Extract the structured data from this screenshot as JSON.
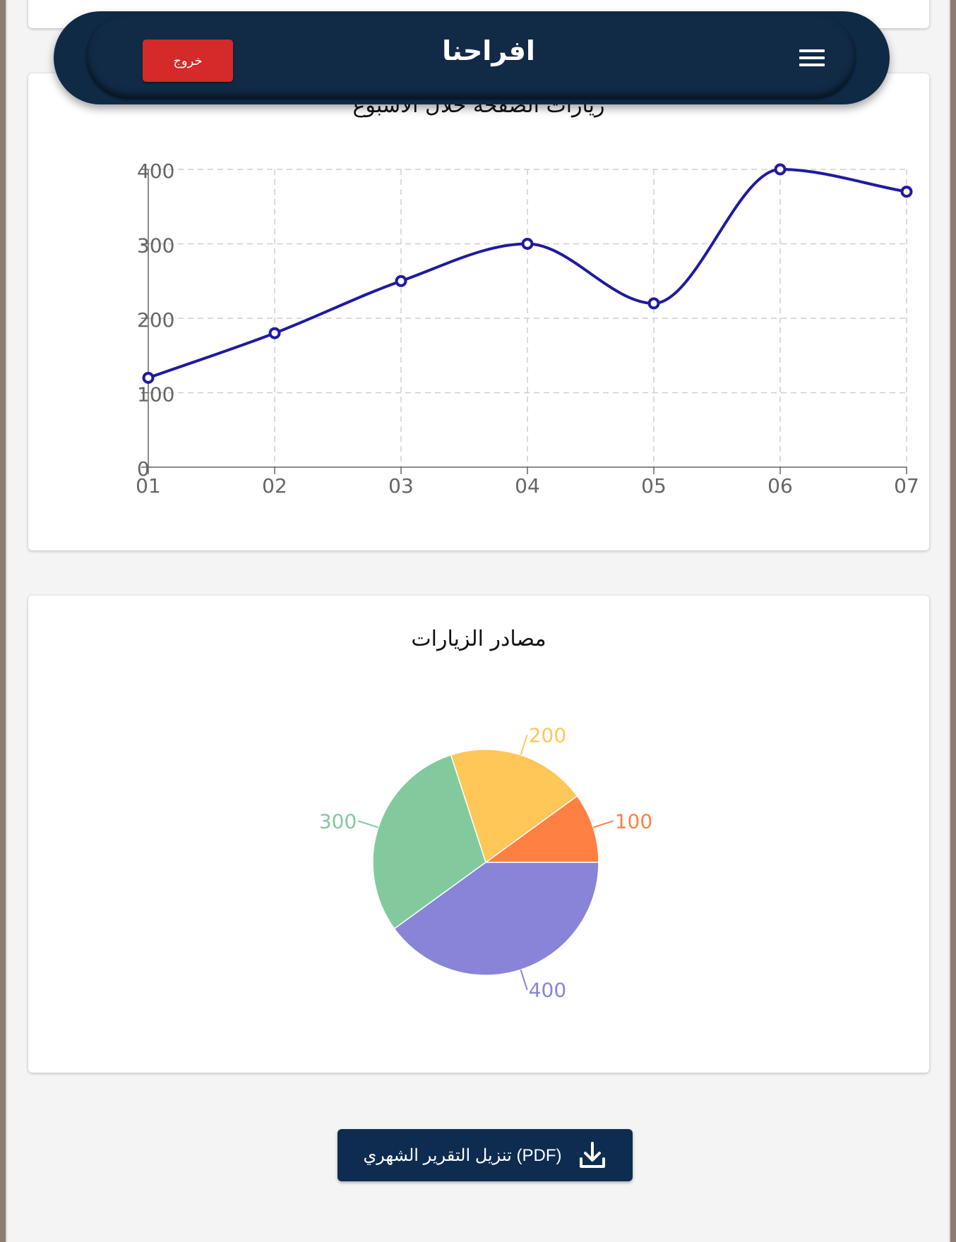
{
  "header": {
    "brand": "افراحنا",
    "logout_label": "خروج",
    "menu_icon": "hamburger-menu-icon"
  },
  "line_chart": {
    "title": "زيارات الصفحة خلال الأسبوع"
  },
  "pie_chart": {
    "title": "مصادر الزيارات"
  },
  "download": {
    "label": "تنزيل التقرير الشهري (PDF)",
    "icon": "download-icon"
  },
  "chart_data": [
    {
      "type": "line",
      "title": "زيارات الصفحة خلال الأسبوع",
      "categories": [
        "01",
        "02",
        "03",
        "04",
        "05",
        "06",
        "07"
      ],
      "series": [
        {
          "values": [
            120,
            180,
            250,
            300,
            220,
            400,
            370
          ],
          "color": "#1f1aa0"
        }
      ],
      "ylim": [
        0,
        400
      ],
      "yticks": [
        0,
        100,
        200,
        300,
        400
      ],
      "grid": true,
      "curve": "smooth"
    },
    {
      "type": "pie",
      "title": "مصادر الزيارات",
      "slices": [
        {
          "value": 100,
          "label": "100",
          "color": "#ff8042"
        },
        {
          "value": 200,
          "label": "200",
          "color": "#ffc658"
        },
        {
          "value": 300,
          "label": "300",
          "color": "#82ca9d"
        },
        {
          "value": 400,
          "label": "400",
          "color": "#8884d8"
        }
      ]
    }
  ]
}
